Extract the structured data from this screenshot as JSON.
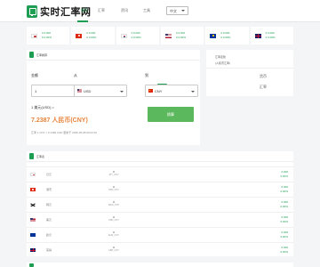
{
  "brand": {
    "name": "实时汇率网"
  },
  "nav": {
    "items": [
      "首页",
      "汇率",
      "资讯",
      "工具"
    ]
  },
  "lang": {
    "value": "中文"
  },
  "ticker": [
    {
      "flag": "jp",
      "rate": "0.000",
      "pct": "0.00%",
      "arrow": "0"
    },
    {
      "flag": "hk",
      "rate": "0.000",
      "pct": "0.00%",
      "arrow": "0"
    },
    {
      "flag": "kr",
      "rate": "0.000",
      "pct": "0.00%",
      "arrow": "0"
    },
    {
      "flag": "us",
      "rate": "0.000",
      "pct": "0.00%",
      "arrow": "0"
    },
    {
      "flag": "eu",
      "rate": "0.000",
      "pct": "0.00%",
      "arrow": "0"
    },
    {
      "flag": "gb",
      "rate": "0.000",
      "pct": "0.00%",
      "arrow": "0"
    }
  ],
  "converter": {
    "title": "汇率换算",
    "amount_label": "金额",
    "from_label": "从",
    "to_label": "到",
    "amount_value": "1",
    "from_currency": "USD",
    "to_currency": "CNY",
    "swap_icon": "⇄",
    "result_line1": "1 美元(USD) =",
    "result_line2": "7.2387 人民币(CNY)",
    "result_line3": "汇率 1 CNY = 0.1382 USD  更新于 2025-05-08 03:02:32",
    "convert_button": "换算"
  },
  "side": {
    "title": "汇率走势",
    "subtitle": "(人民币汇率)",
    "col1": "货币",
    "col2": "汇率"
  },
  "list": {
    "title": "汇率表",
    "rows": [
      {
        "flag": "jp",
        "name": "日元",
        "num": "0",
        "code": "JPY_CNY",
        "rate": "0.000",
        "pct": "0.00%"
      },
      {
        "flag": "hk",
        "name": "港币",
        "num": "0",
        "code": "HKD_CNY",
        "rate": "0.000",
        "pct": "0.00%"
      },
      {
        "flag": "kr",
        "name": "韩元",
        "num": "0",
        "code": "KRW_CNY",
        "rate": "0.000",
        "pct": "0.00%"
      },
      {
        "flag": "us",
        "name": "美元",
        "num": "0",
        "code": "USD_CNY",
        "rate": "0.000",
        "pct": "0.00%"
      },
      {
        "flag": "eu",
        "name": "欧元",
        "num": "0",
        "code": "EUR_CNY",
        "rate": "0.000",
        "pct": "0.00%"
      },
      {
        "flag": "gb",
        "name": "英镑",
        "num": "0",
        "code": "GBP_CNY",
        "rate": "0.000",
        "pct": "0.00%"
      }
    ]
  }
}
